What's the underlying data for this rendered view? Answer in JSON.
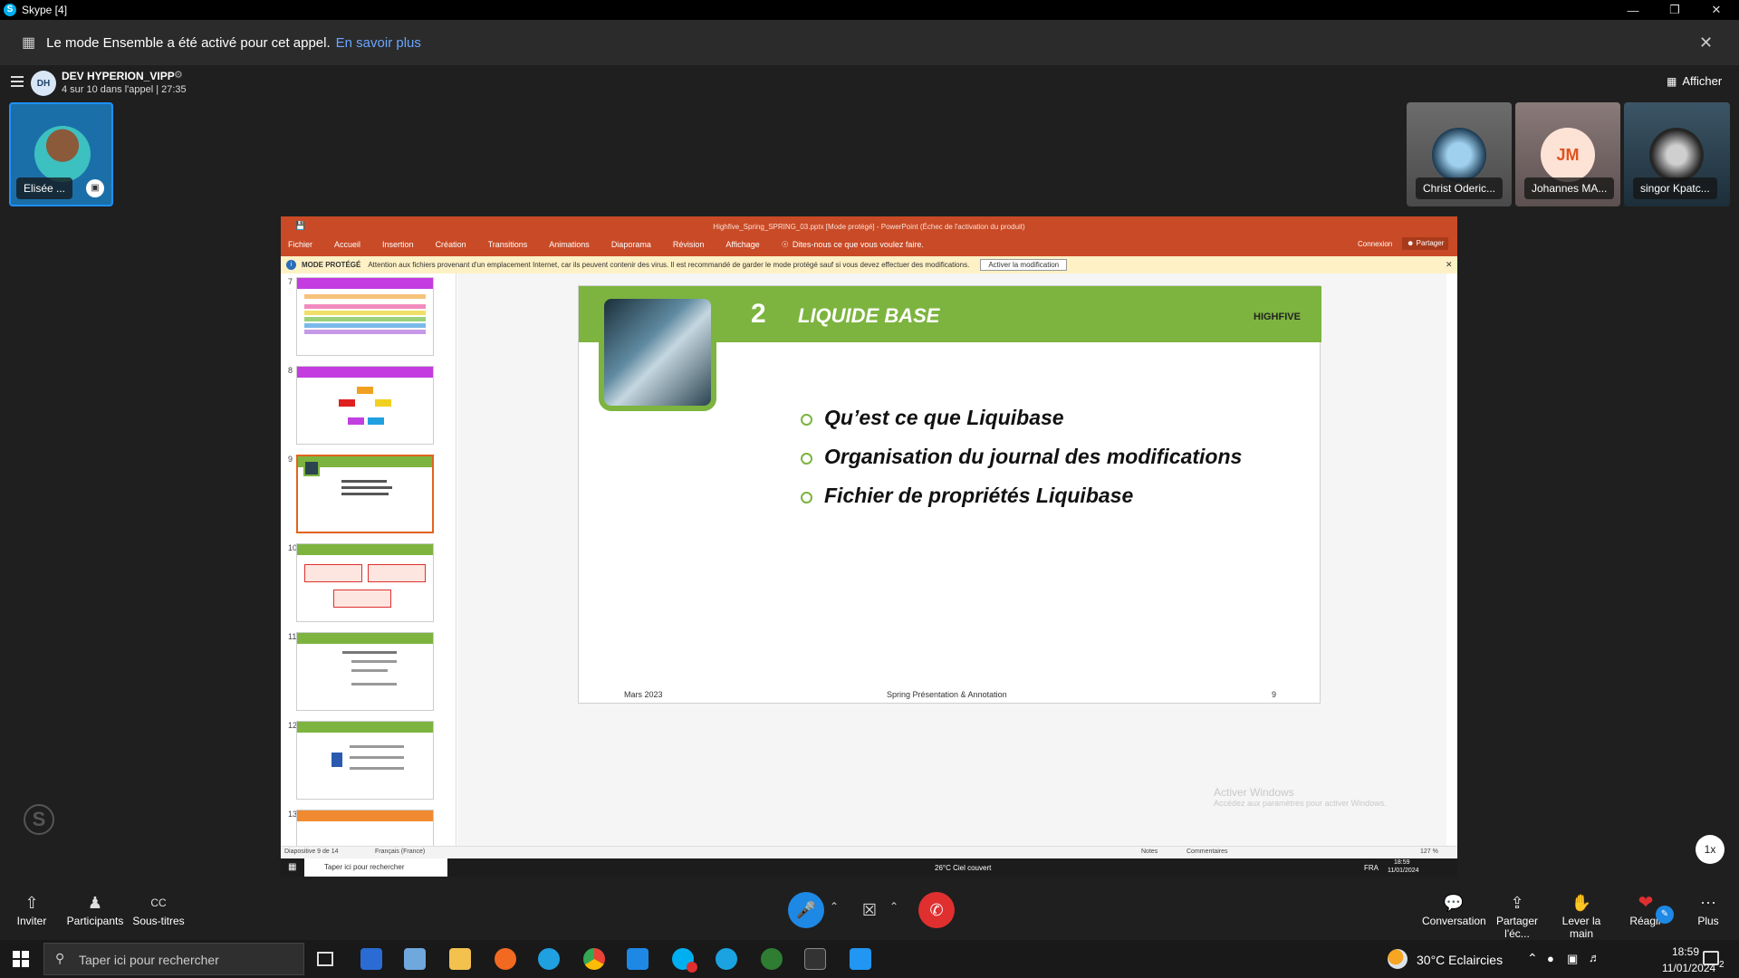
{
  "titlebar": {
    "app_title": "Skype [4]",
    "logo": "S"
  },
  "banner": {
    "message": "Le mode Ensemble a été activé pour cet appel.",
    "link": "En savoir plus"
  },
  "call": {
    "avatar_initials": "DH",
    "name": "DEV HYPERION_VIPP",
    "status": "4 sur 10 dans l'appel | 27:35",
    "afficher": "Afficher"
  },
  "participants": {
    "self": {
      "name": "Elisée ..."
    },
    "others": [
      {
        "name": "Christ Oderic..."
      },
      {
        "name": "Johannes MA...",
        "initials": "JM"
      },
      {
        "name": "singor Kpatc..."
      }
    ]
  },
  "ppt": {
    "title": "Highfive_Spring_SPRING_03.pptx [Mode protégé] - PowerPoint (Échec de l'activation du produit)",
    "tabs": [
      "Fichier",
      "Accueil",
      "Insertion",
      "Création",
      "Transitions",
      "Animations",
      "Diaporama",
      "Révision",
      "Affichage"
    ],
    "tell_me": "Dites-nous ce que vous voulez faire.",
    "connexion": "Connexion",
    "partager": "Partager",
    "protected": {
      "label": "MODE PROTÉGÉ",
      "message": "Attention aux fichiers provenant d'un emplacement Internet, car ils peuvent contenir des virus. Il est recommandé de garder le mode protégé sauf si vous devez effectuer des modifications.",
      "button": "Activer la modification"
    },
    "thumb_numbers": [
      "7",
      "8",
      "9",
      "10",
      "11",
      "12",
      "13"
    ],
    "slide": {
      "number": "2",
      "title": "LIQUIDE BASE",
      "logo": "HIGHFIVE",
      "bullets": [
        "Qu’est ce que Liquibase",
        "Organisation du journal des modifications",
        "Fichier de propriétés Liquibase"
      ],
      "footer_left": "Mars 2023",
      "footer_center": "Spring Présentation & Annotation",
      "footer_right": "9"
    },
    "watermark": {
      "line1": "Activer Windows",
      "line2": "Accédez aux paramètres pour activer Windows."
    },
    "status": {
      "slide_of": "Diapositive 9 de 14",
      "language": "Français (France)",
      "notes": "Notes",
      "comments": "Commentaires",
      "zoom": "127 %"
    },
    "inner_taskbar": {
      "search": "Taper ici pour rechercher",
      "weather": "26°C  Ciel couvert",
      "lang": "FRA",
      "time": "18:59",
      "date": "11/01/2024"
    }
  },
  "speed": "1x",
  "controls": {
    "inviter": "Inviter",
    "participants": "Participants",
    "subtitles": "Sous-titres",
    "conversation": "Conversation",
    "partager": "Partager l'éc...",
    "lever": "Lever la main",
    "reagir": "Réagir",
    "plus": "Plus"
  },
  "taskbar": {
    "search": "Taper ici pour rechercher",
    "weather": "30°C  Eclaircies",
    "time": "18:59",
    "date": "11/01/2024",
    "notif_count": "2"
  },
  "colors": {
    "accent": "#0078d4",
    "hangup": "#e02f2f",
    "ppt": "#c94a26",
    "slide_green": "#7cb43f"
  }
}
